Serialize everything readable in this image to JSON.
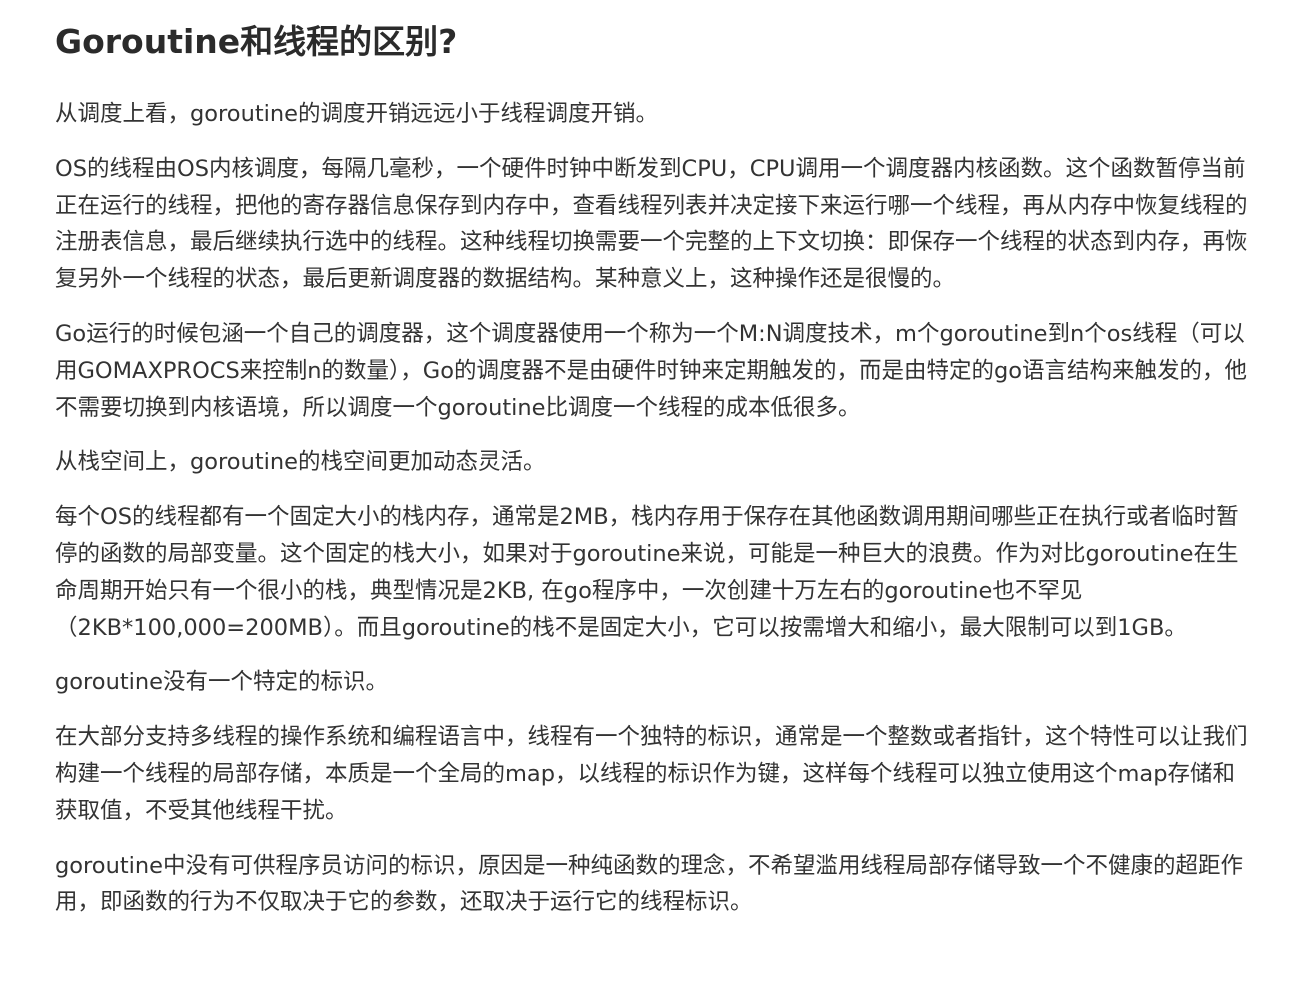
{
  "article": {
    "title": "Goroutine和线程的区别?",
    "paragraphs": [
      "从调度上看，goroutine的调度开销远远小于线程调度开销。",
      "OS的线程由OS内核调度，每隔几毫秒，一个硬件时钟中断发到CPU，CPU调用一个调度器内核函数。这个函数暂停当前正在运行的线程，把他的寄存器信息保存到内存中，查看线程列表并决定接下来运行哪一个线程，再从内存中恢复线程的注册表信息，最后继续执行选中的线程。这种线程切换需要一个完整的上下文切换：即保存一个线程的状态到内存，再恢复另外一个线程的状态，最后更新调度器的数据结构。某种意义上，这种操作还是很慢的。",
      "Go运行的时候包涵一个自己的调度器，这个调度器使用一个称为一个M:N调度技术，m个goroutine到n个os线程（可以用GOMAXPROCS来控制n的数量），Go的调度器不是由硬件时钟来定期触发的，而是由特定的go语言结构来触发的，他不需要切换到内核语境，所以调度一个goroutine比调度一个线程的成本低很多。",
      "从栈空间上，goroutine的栈空间更加动态灵活。",
      "每个OS的线程都有一个固定大小的栈内存，通常是2MB，栈内存用于保存在其他函数调用期间哪些正在执行或者临时暂停的函数的局部变量。这个固定的栈大小，如果对于goroutine来说，可能是一种巨大的浪费。作为对比goroutine在生命周期开始只有一个很小的栈，典型情况是2KB, 在go程序中，一次创建十万左右的goroutine也不罕见（2KB*100,000=200MB）。而且goroutine的栈不是固定大小，它可以按需增大和缩小，最大限制可以到1GB。",
      "goroutine没有一个特定的标识。",
      "在大部分支持多线程的操作系统和编程语言中，线程有一个独特的标识，通常是一个整数或者指针，这个特性可以让我们构建一个线程的局部存储，本质是一个全局的map，以线程的标识作为键，这样每个线程可以独立使用这个map存储和获取值，不受其他线程干扰。",
      "goroutine中没有可供程序员访问的标识，原因是一种纯函数的理念，不希望滥用线程局部存储导致一个不健康的超距作用，即函数的行为不仅取决于它的参数，还取决于运行它的线程标识。"
    ]
  },
  "colors": {
    "background": "#ffffff",
    "title_text": "#2b2b2b",
    "body_text": "#333333"
  }
}
